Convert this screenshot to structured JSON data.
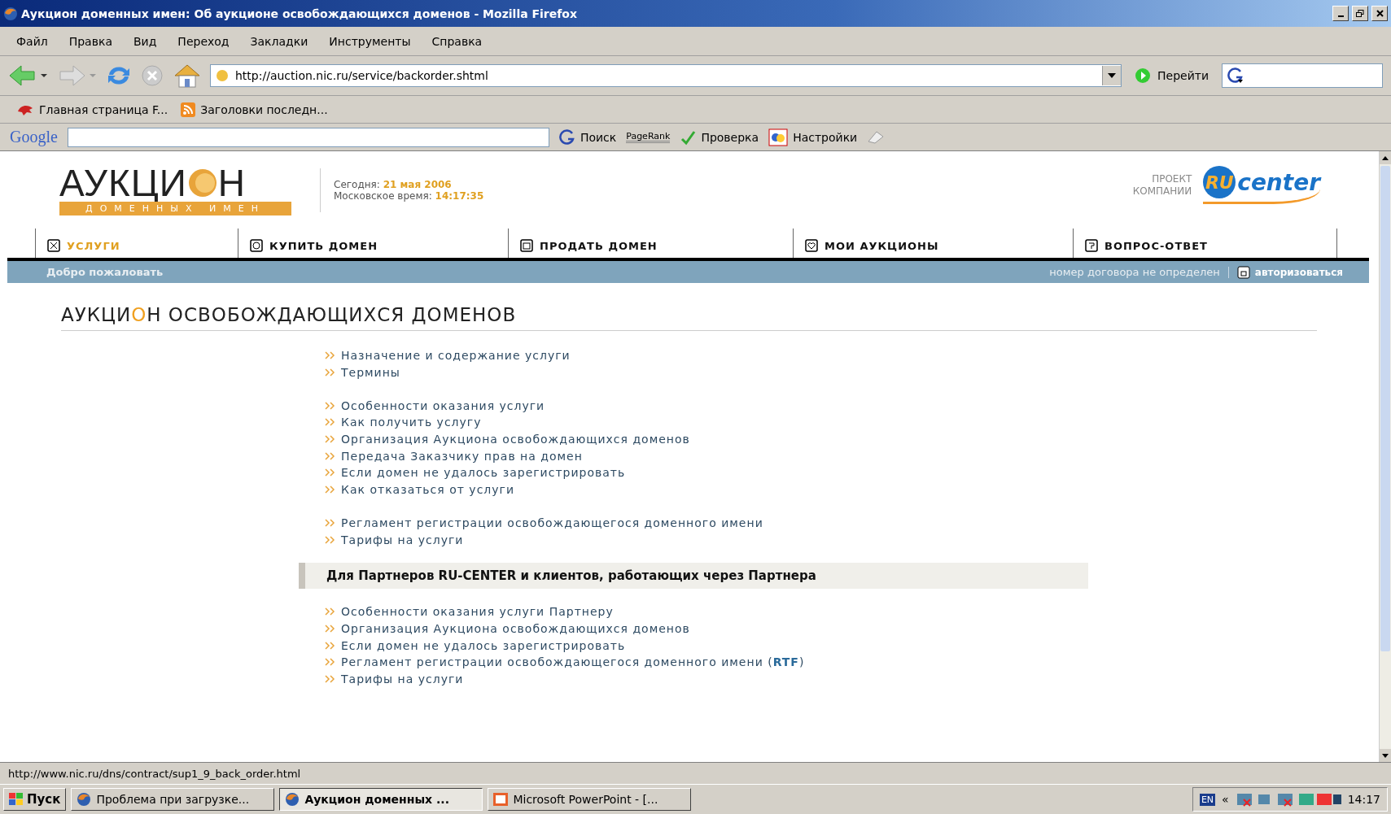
{
  "window": {
    "title": "Аукцион доменных имен: Об аукционе освобождающихся доменов - Mozilla Firefox"
  },
  "menu": [
    "Файл",
    "Правка",
    "Вид",
    "Переход",
    "Закладки",
    "Инструменты",
    "Справка"
  ],
  "address_bar": {
    "url": "http://auction.nic.ru/service/backorder.shtml",
    "go": "Перейти"
  },
  "bookmarks": [
    "Главная страница F...",
    "Заголовки последн..."
  ],
  "google_toolbar": {
    "logo": "Google",
    "search": "Поиск",
    "pagerank": "PageRank",
    "check": "Проверка",
    "settings": "Настройки"
  },
  "header": {
    "logo_start": "АУКЦИ",
    "logo_end": "Н",
    "logo_sub": "ДОМЕННЫХ ИМЕН",
    "today_label": "Сегодня:",
    "today": "21 мая 2006",
    "time_label": "Московское время:",
    "time": "14:17:35",
    "project_1": "ПРОЕКТ",
    "project_2": "КОМПАНИИ",
    "brand_mark": "RU",
    "brand_word": "center"
  },
  "tabs": [
    {
      "label": "УСЛУГИ",
      "selected": true
    },
    {
      "label": "КУПИТЬ ДОМЕН",
      "selected": false
    },
    {
      "label": "ПРОДАТЬ ДОМЕН",
      "selected": false
    },
    {
      "label": "МОИ АУКЦИОНЫ",
      "selected": false
    },
    {
      "label": "ВОПРОС-ОТВЕТ",
      "selected": false
    }
  ],
  "user_bar": {
    "welcome": "Добро пожаловать",
    "contract": "номер договора не определен",
    "login": "авторизоваться"
  },
  "heading": {
    "start": "АУКЦИ",
    "accent": "О",
    "end": "Н ОСВОБОЖДАЮЩИХСЯ ДОМЕНОВ"
  },
  "link_groups": [
    [
      "Назначение и содержание услуги",
      "Термины"
    ],
    [
      "Особенности оказания услуги",
      "Как получить услугу",
      "Организация Аукциона освобождающихся доменов",
      "Передача Заказчику прав на домен",
      "Если домен не удалось зарегистрировать",
      "Как отказаться от услуги"
    ],
    [
      "Регламент регистрации освобождающегося доменного имени",
      "Тарифы на услуги"
    ]
  ],
  "partner_section": {
    "title": "Для Партнеров RU-CENTER и клиентов, работающих через Партнера",
    "links": [
      "Особенности оказания услуги Партнеру",
      "Организация Аукциона освобождающихся доменов",
      "Если домен не удалось зарегистрировать",
      "Регламент регистрации освобождающегося доменного имени (**RTF**)",
      "Тарифы на услуги"
    ]
  },
  "status_bar": "http://www.nic.ru/dns/contract/sup1_9_back_order.html",
  "taskbar": {
    "start": "Пуск",
    "tasks": [
      {
        "label": "Проблема при загрузке...",
        "selected": false,
        "kind": "browser"
      },
      {
        "label": "Аукцион доменных ...",
        "selected": true,
        "kind": "browser"
      },
      {
        "label": "Microsoft PowerPoint - [...",
        "selected": false,
        "kind": "slides"
      }
    ],
    "language": "EN",
    "expand": "«",
    "clock": "14:17"
  }
}
